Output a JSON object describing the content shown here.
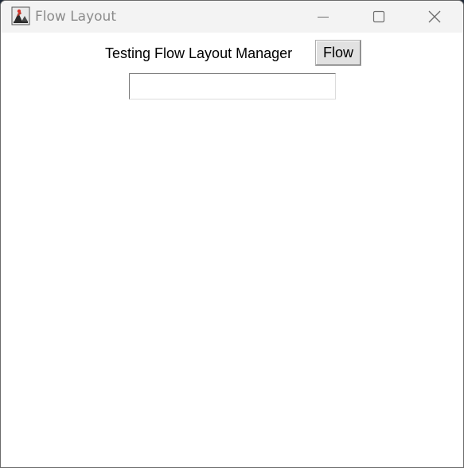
{
  "window": {
    "title": "Flow Layout",
    "icon": "java-duke-icon",
    "controls": {
      "minimize": "minimize-icon",
      "maximize": "maximize-icon",
      "close": "close-icon"
    }
  },
  "content": {
    "label": "Testing Flow Layout Manager",
    "button_label": "Flow",
    "text_field_value": ""
  },
  "colors": {
    "titlebar_bg": "#f3f3f3",
    "title_text": "#8b8b8b",
    "content_bg": "#ffffff",
    "button_bg": "#e1e1e1"
  }
}
